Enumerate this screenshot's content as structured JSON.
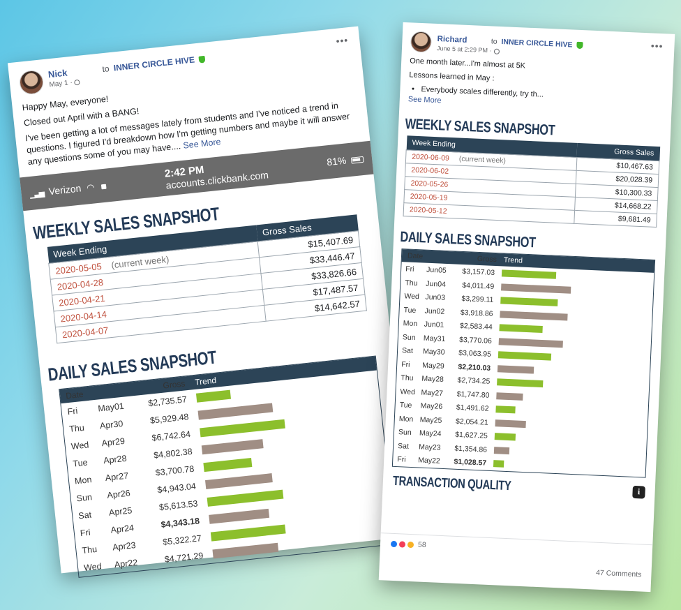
{
  "left_post": {
    "author": "Nick",
    "group_prefix": "to",
    "group": "INNER CIRCLE HIVE",
    "timestamp": "May 1 ·",
    "more": "•••",
    "paragraphs": [
      "Happy May, everyone!",
      "Closed out April with a BANG!",
      "I've been getting a lot of messages lately from students and I've noticed a trend in questions. I figured I'd breakdown how I'm getting numbers and maybe it will answer any questions some of you may have...."
    ],
    "see_more": "See More",
    "status_bar": {
      "carrier": "Verizon",
      "time": "2:42 PM",
      "url": "accounts.clickbank.com",
      "battery": "81%"
    },
    "weekly": {
      "title": "WEEKLY SALES SNAPSHOT",
      "col_week": "Week Ending",
      "col_gross": "Gross Sales",
      "current_note": "(current week)",
      "rows": [
        {
          "date": "2020-05-05",
          "amount": "$15,407.69"
        },
        {
          "date": "2020-04-28",
          "amount": "$33,446.47"
        },
        {
          "date": "2020-04-21",
          "amount": "$33,826.66"
        },
        {
          "date": "2020-04-14",
          "amount": "$17,487.57"
        },
        {
          "date": "2020-04-07",
          "amount": "$14,642.57"
        }
      ]
    },
    "daily": {
      "title": "DAILY SALES SNAPSHOT",
      "col_date": "Date",
      "col_gross": "Gross",
      "col_trend": "Trend",
      "rows": [
        {
          "day": "Fri",
          "date": "May01",
          "gross": "$2,735.57",
          "bold": false,
          "trend": 0.38,
          "color": "green"
        },
        {
          "day": "Thu",
          "date": "Apr30",
          "gross": "$5,929.48",
          "bold": false,
          "trend": 0.82,
          "color": "brown"
        },
        {
          "day": "Wed",
          "date": "Apr29",
          "gross": "$6,742.64",
          "bold": false,
          "trend": 0.94,
          "color": "green"
        },
        {
          "day": "Tue",
          "date": "Apr28",
          "gross": "$4,802.38",
          "bold": false,
          "trend": 0.68,
          "color": "brown"
        },
        {
          "day": "Mon",
          "date": "Apr27",
          "gross": "$3,700.78",
          "bold": false,
          "trend": 0.53,
          "color": "green"
        },
        {
          "day": "Sun",
          "date": "Apr26",
          "gross": "$4,943.04",
          "bold": false,
          "trend": 0.74,
          "color": "brown"
        },
        {
          "day": "Sat",
          "date": "Apr25",
          "gross": "$5,613.53",
          "bold": false,
          "trend": 0.84,
          "color": "green"
        },
        {
          "day": "Fri",
          "date": "Apr24",
          "gross": "$4,343.18",
          "bold": true,
          "trend": 0.66,
          "color": "brown"
        },
        {
          "day": "Thu",
          "date": "Apr23",
          "gross": "$5,322.27",
          "bold": false,
          "trend": 0.82,
          "color": "green"
        },
        {
          "day": "Wed",
          "date": "Apr22",
          "gross": "$4,721.29",
          "bold": false,
          "trend": 0.72,
          "color": "brown"
        }
      ]
    }
  },
  "right_post": {
    "author": "Richard",
    "group_prefix": "to",
    "group": "INNER CIRCLE HIVE",
    "timestamp": "June 5 at 2:29 PM ·",
    "more": "•••",
    "paragraphs": [
      "One month later...I'm almost at 5K",
      "Lessons learned in May :"
    ],
    "bullet": "Everybody scales differently, try th...",
    "see_more": "See More",
    "weekly": {
      "title": "WEEKLY SALES SNAPSHOT",
      "col_week": "Week Ending",
      "col_gross": "Gross Sales",
      "current_note": "(current week)",
      "rows": [
        {
          "date": "2020-06-09",
          "amount": "$10,467.63"
        },
        {
          "date": "2020-06-02",
          "amount": "$20,028.39"
        },
        {
          "date": "2020-05-26",
          "amount": "$10,300.33"
        },
        {
          "date": "2020-05-19",
          "amount": "$14,668.22"
        },
        {
          "date": "2020-05-12",
          "amount": "$9,681.49"
        }
      ]
    },
    "daily": {
      "title": "DAILY SALES SNAPSHOT",
      "col_date": "Date",
      "col_gross": "Gross",
      "col_trend": "Trend",
      "rows": [
        {
          "day": "Fri",
          "date": "Jun05",
          "gross": "$3,157.03",
          "bold": false,
          "trend": 0.78,
          "color": "green"
        },
        {
          "day": "Thu",
          "date": "Jun04",
          "gross": "$4,011.49",
          "bold": false,
          "trend": 1.0,
          "color": "brown"
        },
        {
          "day": "Wed",
          "date": "Jun03",
          "gross": "$3,299.11",
          "bold": false,
          "trend": 0.82,
          "color": "green"
        },
        {
          "day": "Tue",
          "date": "Jun02",
          "gross": "$3,918.86",
          "bold": false,
          "trend": 0.97,
          "color": "brown"
        },
        {
          "day": "Mon",
          "date": "Jun01",
          "gross": "$2,583.44",
          "bold": false,
          "trend": 0.62,
          "color": "green"
        },
        {
          "day": "Sun",
          "date": "May31",
          "gross": "$3,770.06",
          "bold": false,
          "trend": 0.92,
          "color": "brown"
        },
        {
          "day": "Sat",
          "date": "May30",
          "gross": "$3,063.95",
          "bold": false,
          "trend": 0.76,
          "color": "green"
        },
        {
          "day": "Fri",
          "date": "May29",
          "gross": "$2,210.03",
          "bold": true,
          "trend": 0.52,
          "color": "brown"
        },
        {
          "day": "Thu",
          "date": "May28",
          "gross": "$2,734.25",
          "bold": false,
          "trend": 0.66,
          "color": "green"
        },
        {
          "day": "Wed",
          "date": "May27",
          "gross": "$1,747.80",
          "bold": false,
          "trend": 0.38,
          "color": "brown"
        },
        {
          "day": "Tue",
          "date": "May26",
          "gross": "$1,491.62",
          "bold": false,
          "trend": 0.28,
          "color": "green"
        },
        {
          "day": "Mon",
          "date": "May25",
          "gross": "$2,054.21",
          "bold": false,
          "trend": 0.44,
          "color": "brown"
        },
        {
          "day": "Sun",
          "date": "May24",
          "gross": "$1,627.25",
          "bold": false,
          "trend": 0.3,
          "color": "green"
        },
        {
          "day": "Sat",
          "date": "May23",
          "gross": "$1,354.86",
          "bold": false,
          "trend": 0.22,
          "color": "brown"
        },
        {
          "day": "Fri",
          "date": "May22",
          "gross": "$1,028.57",
          "bold": true,
          "trend": 0.15,
          "color": "green"
        }
      ]
    },
    "transaction_title": "TRANSACTION QUALITY",
    "info": "i",
    "reaction_count": "58",
    "comments": "47 Comments"
  },
  "colors": {
    "bar_green": "#8cbf2c",
    "bar_brown": "#a08e84",
    "table_header": "#2c4457",
    "date_red": "#c0523f",
    "link_blue": "#385898"
  }
}
